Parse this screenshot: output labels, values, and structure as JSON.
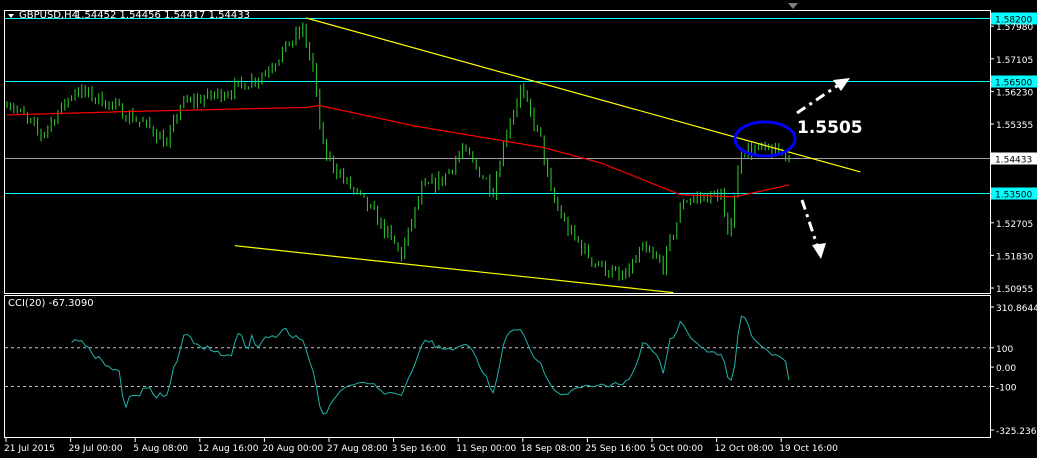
{
  "window": {
    "symbol_title": "GBPUSD,H4",
    "ohlc": "1.54452 1.54456 1.54417 1.54433"
  },
  "indicator": {
    "title": "CCI(20) -67.3090"
  },
  "annotation": {
    "label": "1.5505"
  },
  "colors": {
    "background": "#000000",
    "bars": "#32cd32",
    "ma": "#ff0000",
    "trendline": "#ffff00",
    "level": "#00ffff",
    "bid": "#a0a0a0",
    "cci": "#20b2aa",
    "ellipse": "#0000ff",
    "arrow": "#ffffff"
  },
  "chart_data": {
    "type": "line",
    "title": "GBPUSD,H4",
    "price_axis": {
      "range": [
        1.50955,
        1.582
      ],
      "ticks": [
        "1.57980",
        "1.57105",
        "1.56230",
        "1.55355",
        "1.54433",
        "1.52705",
        "1.51830",
        "1.50955"
      ]
    },
    "levels": [
      {
        "label": "1.58200",
        "value": 1.582
      },
      {
        "label": "1.56500",
        "value": 1.565
      },
      {
        "label": "1.53500",
        "value": 1.535
      }
    ],
    "bid": {
      "label": "1.54433",
      "value": 1.54433
    },
    "time_axis": {
      "labels": [
        "21 Jul 2015",
        "29 Jul 00:00",
        "5 Aug 08:00",
        "12 Aug 16:00",
        "20 Aug 00:00",
        "27 Aug 08:00",
        "3 Sep 16:00",
        "11 Sep 00:00",
        "18 Sep 08:00",
        "25 Sep 16:00",
        "5 Oct 00:00",
        "12 Oct 08:00",
        "19 Oct 16:00"
      ],
      "bars_per_label": 19
    },
    "bar_count": 231,
    "close_waypoints": [
      [
        0,
        1.56
      ],
      [
        10,
        1.5506
      ],
      [
        20,
        1.5627
      ],
      [
        28,
        1.56
      ],
      [
        43,
        1.552
      ],
      [
        47,
        1.548
      ],
      [
        51,
        1.5587
      ],
      [
        66,
        1.5627
      ],
      [
        75,
        1.5667
      ],
      [
        84,
        1.5761
      ],
      [
        87,
        1.5788
      ],
      [
        90,
        1.5681
      ],
      [
        93,
        1.5466
      ],
      [
        99,
        1.5386
      ],
      [
        107,
        1.5305
      ],
      [
        116,
        1.5185
      ],
      [
        122,
        1.5359
      ],
      [
        128,
        1.5386
      ],
      [
        134,
        1.5466
      ],
      [
        143,
        1.5359
      ],
      [
        147,
        1.552
      ],
      [
        151,
        1.5627
      ],
      [
        157,
        1.5493
      ],
      [
        160,
        1.5346
      ],
      [
        165,
        1.5252
      ],
      [
        172,
        1.5171
      ],
      [
        181,
        1.5118
      ],
      [
        187,
        1.5198
      ],
      [
        193,
        1.5158
      ],
      [
        199,
        1.5332
      ],
      [
        210,
        1.5346
      ],
      [
        212,
        1.5225
      ],
      [
        216,
        1.5466
      ],
      [
        222,
        1.5466
      ],
      [
        230,
        1.5453
      ]
    ],
    "moving_average": [
      [
        0,
        1.556
      ],
      [
        40,
        1.557
      ],
      [
        88,
        1.558
      ],
      [
        92,
        1.5585
      ],
      [
        120,
        1.553
      ],
      [
        158,
        1.5472
      ],
      [
        175,
        1.543
      ],
      [
        198,
        1.5346
      ],
      [
        214,
        1.534
      ],
      [
        230,
        1.5372
      ]
    ],
    "trendlines": [
      {
        "name": "upper",
        "points": [
          [
            88,
            1.582
          ],
          [
            251,
            1.5407
          ]
        ]
      },
      {
        "name": "lower",
        "points": [
          [
            67,
            1.5209
          ],
          [
            196,
            1.5083
          ]
        ]
      }
    ],
    "cci": {
      "period": 20,
      "last": -67.309,
      "range": [
        -325.2368,
        310.8644
      ],
      "ticks": [
        "310.8644",
        "100",
        "0.00",
        "-100",
        "-325.2368"
      ],
      "levels": [
        100,
        -100
      ]
    }
  }
}
